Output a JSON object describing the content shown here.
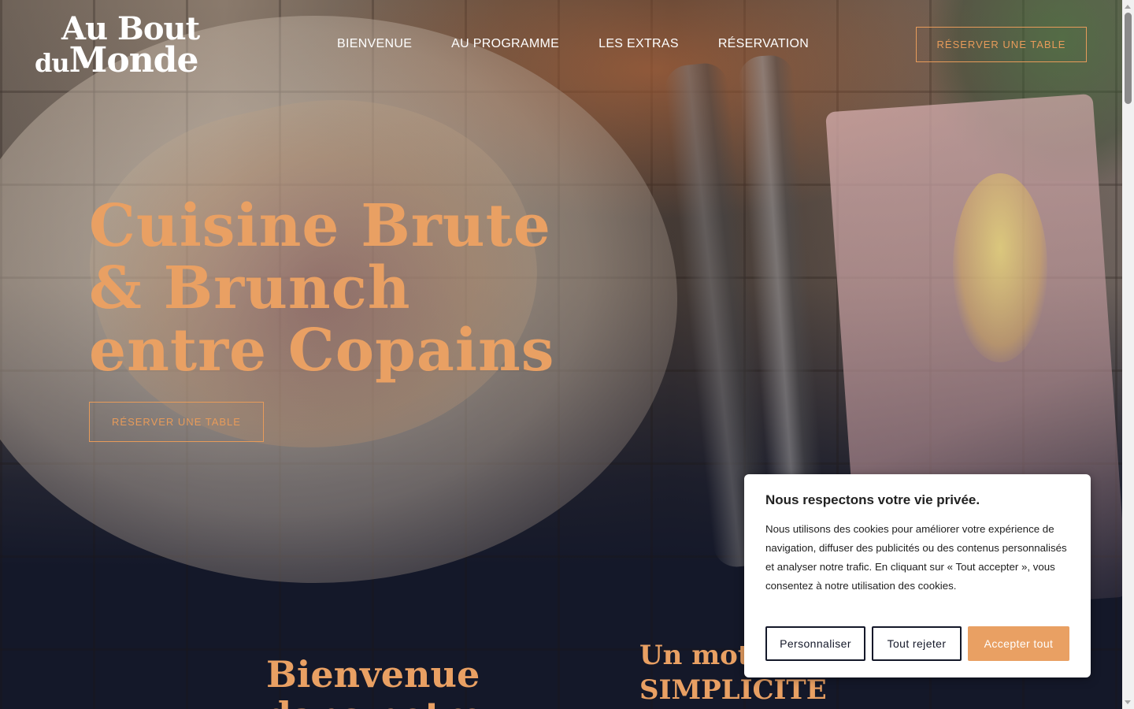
{
  "brand": {
    "logo_line1": "Au Bout",
    "logo_line2_small": "du",
    "logo_line2_big": "Monde"
  },
  "nav": {
    "items": [
      {
        "label": "BIENVENUE"
      },
      {
        "label": "AU PROGRAMME"
      },
      {
        "label": "LES EXTRAS"
      },
      {
        "label": "RÉSERVATION"
      }
    ],
    "cta_label": "RÉSERVER UNE TABLE"
  },
  "hero": {
    "title_lines": [
      "Cuisine Brute",
      "& Brunch",
      "entre Copains"
    ],
    "cta_label": "RÉSERVER UNE TABLE"
  },
  "sections": {
    "welcome_title_lines": [
      "Bienvenue",
      "dans notre"
    ],
    "word_title_lines": [
      "Un mot",
      "SIMPLICITÉ"
    ]
  },
  "cookie": {
    "title": "Nous respectons votre vie privée.",
    "body": "Nous utilisons des cookies pour améliorer votre expérience de navigation, diffuser des publicités ou des contenus personnalisés et analyser notre trafic. En cliquant sur « Tout accepter », vous consentez à notre utilisation des cookies.",
    "customize_label": "Personnaliser",
    "reject_label": "Tout rejeter",
    "accept_label": "Accepter tout"
  },
  "colors": {
    "accent": "#e9a063",
    "background": "#141829",
    "text_light": "#ffffff"
  }
}
